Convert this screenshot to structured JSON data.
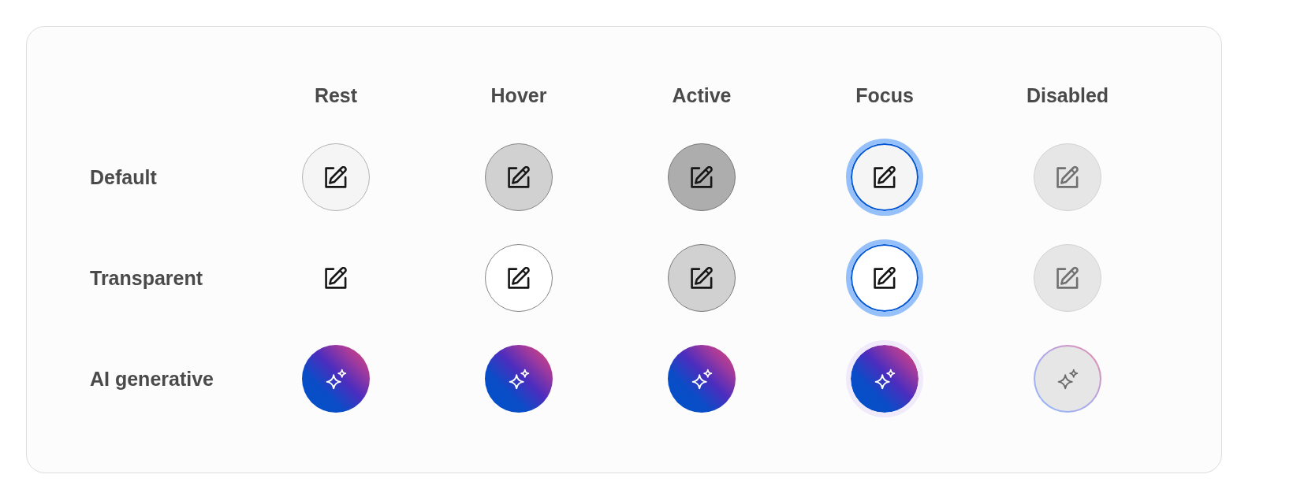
{
  "columns": [
    "Rest",
    "Hover",
    "Active",
    "Focus",
    "Disabled"
  ],
  "rows": [
    {
      "label": "Default",
      "kind": "default",
      "buttons": [
        {
          "hovered": false,
          "pressed": false,
          "focused": false,
          "disabled": false
        },
        {
          "hovered": true,
          "pressed": false,
          "focused": false,
          "disabled": false
        },
        {
          "hovered": false,
          "pressed": true,
          "focused": false,
          "disabled": false
        },
        {
          "hovered": false,
          "pressed": false,
          "focused": true,
          "disabled": false
        },
        {
          "hovered": false,
          "pressed": false,
          "focused": false,
          "disabled": true
        }
      ]
    },
    {
      "label": "Transparent",
      "kind": "transparent",
      "buttons": [
        {
          "hovered": false,
          "pressed": false,
          "focused": false,
          "disabled": false
        },
        {
          "hovered": true,
          "pressed": false,
          "focused": false,
          "disabled": false
        },
        {
          "hovered": false,
          "pressed": true,
          "focused": false,
          "disabled": false
        },
        {
          "hovered": false,
          "pressed": false,
          "focused": true,
          "disabled": false
        },
        {
          "hovered": false,
          "pressed": false,
          "focused": false,
          "disabled": true
        }
      ]
    },
    {
      "label": "AI generative",
      "kind": "ai",
      "buttons": [
        {
          "focused": false,
          "disabled": false
        },
        {
          "focused": false,
          "disabled": false
        },
        {
          "focused": false,
          "disabled": false
        },
        {
          "focused": true,
          "disabled": false
        },
        {
          "focused": false,
          "disabled": true
        }
      ]
    }
  ]
}
